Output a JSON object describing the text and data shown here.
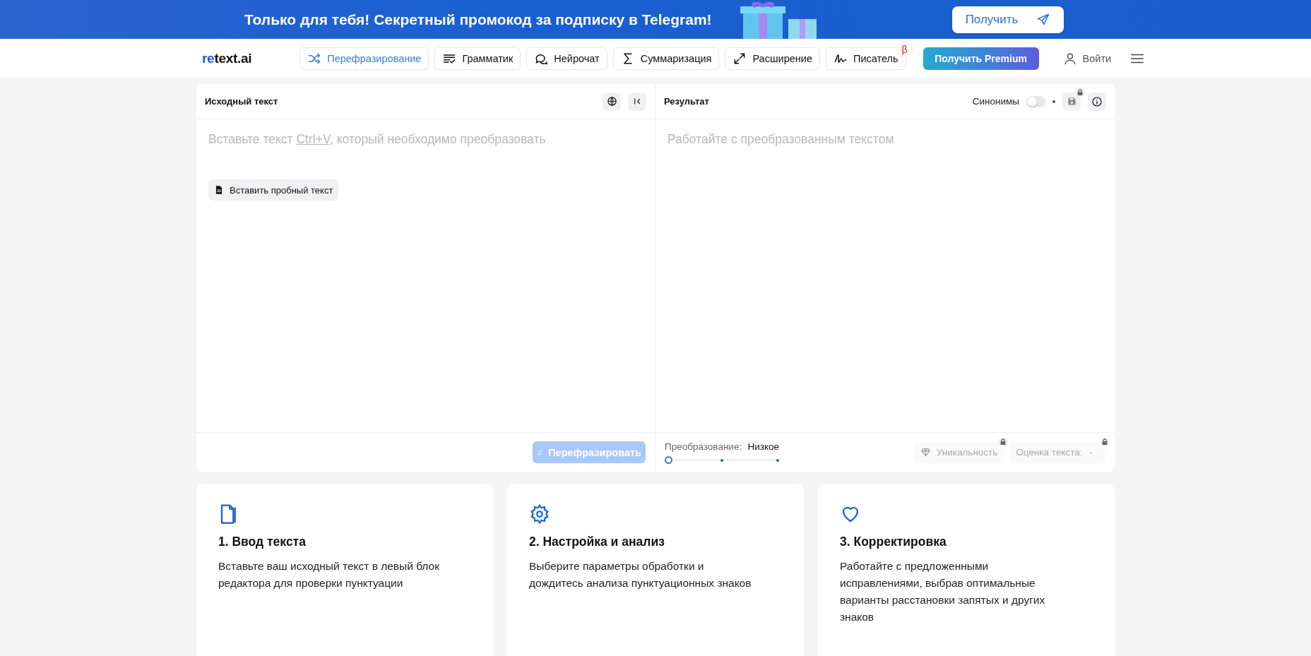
{
  "banner": {
    "text": "Только для тебя! Секретный промокод за подписку в Telegram!",
    "button": "Получить"
  },
  "header": {
    "logo": {
      "accent": "re",
      "rest": "text.ai"
    },
    "nav": [
      {
        "label": "Перефразирование",
        "selected": true
      },
      {
        "label": "Грамматик",
        "selected": false
      },
      {
        "label": "Нейрочат",
        "selected": false
      },
      {
        "label": "Суммаризация",
        "selected": false
      },
      {
        "label": "Расширение",
        "selected": false
      },
      {
        "label": "Писатель",
        "selected": false,
        "badge": "β"
      }
    ],
    "premium_button": "Получить Premium",
    "login": "Войти"
  },
  "source_panel": {
    "title": "Исходный текст",
    "placeholder": {
      "before": "Вставьте текст ",
      "shortcut": "Ctrl+V",
      "after": ", который необходимо преобразовать"
    },
    "sample_button": "Вставить пробный текст",
    "action_button": {
      "label": "Перефразировать",
      "disabled": true
    }
  },
  "result_panel": {
    "title": "Результат",
    "synonyms": {
      "label": "Синонимы",
      "on": false
    },
    "placeholder": "Работайте с преобразованным текстом",
    "transformation": {
      "label": "Преобразование:",
      "value": "Низкое",
      "level": 0
    },
    "uniqueness": {
      "label": "Уникальность",
      "locked": true
    },
    "text_score": {
      "label": "Оценка текста:",
      "value": "-",
      "locked": true
    }
  },
  "steps": [
    {
      "title": "1. Ввод текста",
      "text": "Вставьте ваш исходный текст в левый блок редактора для проверки пунктуации"
    },
    {
      "title": "2. Настройка и анализ",
      "text": "Выберите параметры обработки и дождитесь анализа пунктуационных знаков"
    },
    {
      "title": "3. Корректировка",
      "text": "Работайте с предложенными исправлениями, выбрав оптимальные варианты расстановки запятых и других знаков"
    }
  ]
}
